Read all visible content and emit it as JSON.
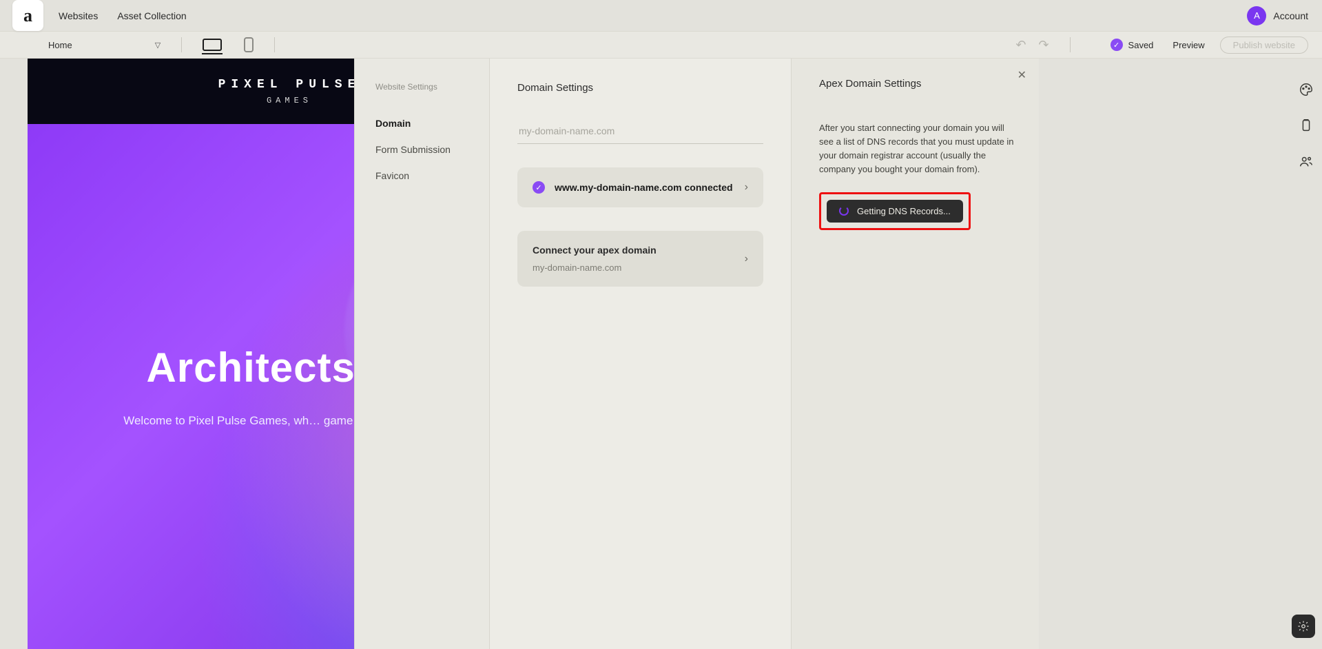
{
  "header": {
    "logo_glyph": "a",
    "nav": {
      "websites": "Websites",
      "assets": "Asset Collection"
    },
    "account": {
      "initial": "A",
      "label": "Account"
    }
  },
  "toolbar": {
    "page_label": "Home",
    "saved_label": "Saved",
    "preview_label": "Preview",
    "publish_label": "Publish website"
  },
  "canvas": {
    "brand_line1": "PIXEL PULSE",
    "brand_line2": "GAMES",
    "hero_title": "Architects of I",
    "hero_sub": "Welcome to Pixel Pulse Games, wh… game is a product of mas"
  },
  "settings_nav": {
    "title": "Website Settings",
    "items": [
      {
        "label": "Domain",
        "active": true
      },
      {
        "label": "Form Submission",
        "active": false
      },
      {
        "label": "Favicon",
        "active": false
      }
    ]
  },
  "domain_panel": {
    "title": "Domain Settings",
    "input_placeholder": "my-domain-name.com",
    "connected_text": "www.my-domain-name.com connected",
    "apex_title": "Connect your apex domain",
    "apex_sub": "my-domain-name.com"
  },
  "apex_panel": {
    "title": "Apex Domain Settings",
    "info": "After you start connecting your domain you will see a list of DNS records that you must update in your domain registrar account (usually the company you bought your domain from).",
    "dns_button": "Getting DNS Records..."
  },
  "colors": {
    "accent_purple": "#7a36f0",
    "highlight_red": "#e11"
  }
}
